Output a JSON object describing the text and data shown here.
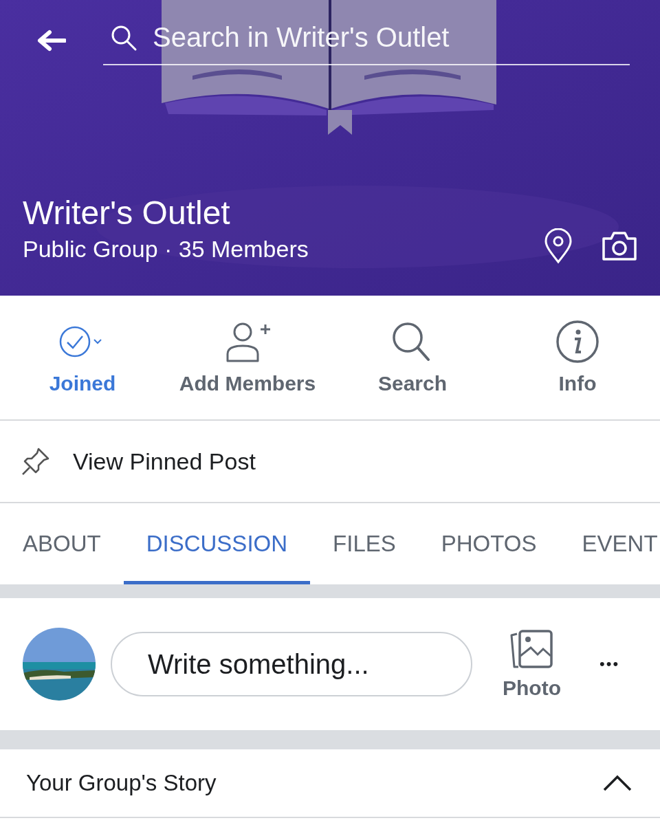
{
  "header": {
    "search": {
      "placeholder": "Search in Writer's Outlet"
    },
    "group_name": "Writer's Outlet",
    "group_meta": "Public Group · 35 Members"
  },
  "actions": [
    {
      "label": "Joined",
      "kind": "joined",
      "selected": true
    },
    {
      "label": "Add Members",
      "kind": "add",
      "selected": false
    },
    {
      "label": "Search",
      "kind": "search",
      "selected": false
    },
    {
      "label": "Info",
      "kind": "info",
      "selected": false
    }
  ],
  "pinned": {
    "label": "View Pinned Post"
  },
  "tabs": [
    {
      "label": "ABOUT",
      "selected": false
    },
    {
      "label": "DISCUSSION",
      "selected": true
    },
    {
      "label": "FILES",
      "selected": false
    },
    {
      "label": "PHOTOS",
      "selected": false
    },
    {
      "label": "EVENT",
      "selected": false
    }
  ],
  "composer": {
    "placeholder": "Write something...",
    "photo_label": "Photo",
    "more": "•••"
  },
  "story": {
    "title": "Your Group's Story",
    "expanded": true
  }
}
